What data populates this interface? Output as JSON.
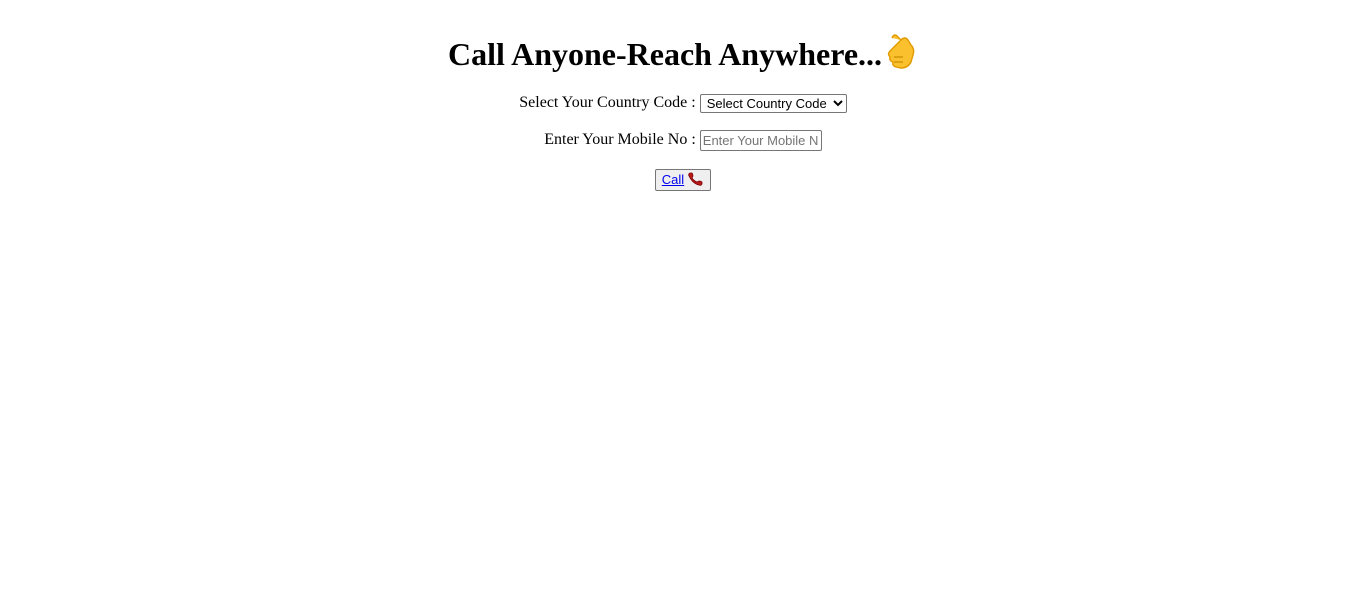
{
  "header": {
    "title": "Call Anyone-Reach Anywhere...",
    "title_icon": "call-me-hand-icon"
  },
  "form": {
    "country_label": "Select Your Country Code :",
    "country_select": {
      "selected": "Select Country Code",
      "options": [
        "Select Country Code"
      ]
    },
    "mobile_label": "Enter Your Mobile No :",
    "mobile_input": {
      "value": "",
      "placeholder": "Enter Your Mobile No"
    },
    "call_button": {
      "label": "Call",
      "icon": "telephone-receiver-icon"
    }
  },
  "colors": {
    "link": "#0000ee",
    "button_bg": "#efefef",
    "border": "#767676",
    "hand_yellow": "#fbc02d",
    "phone_red": "#b71c1c"
  }
}
